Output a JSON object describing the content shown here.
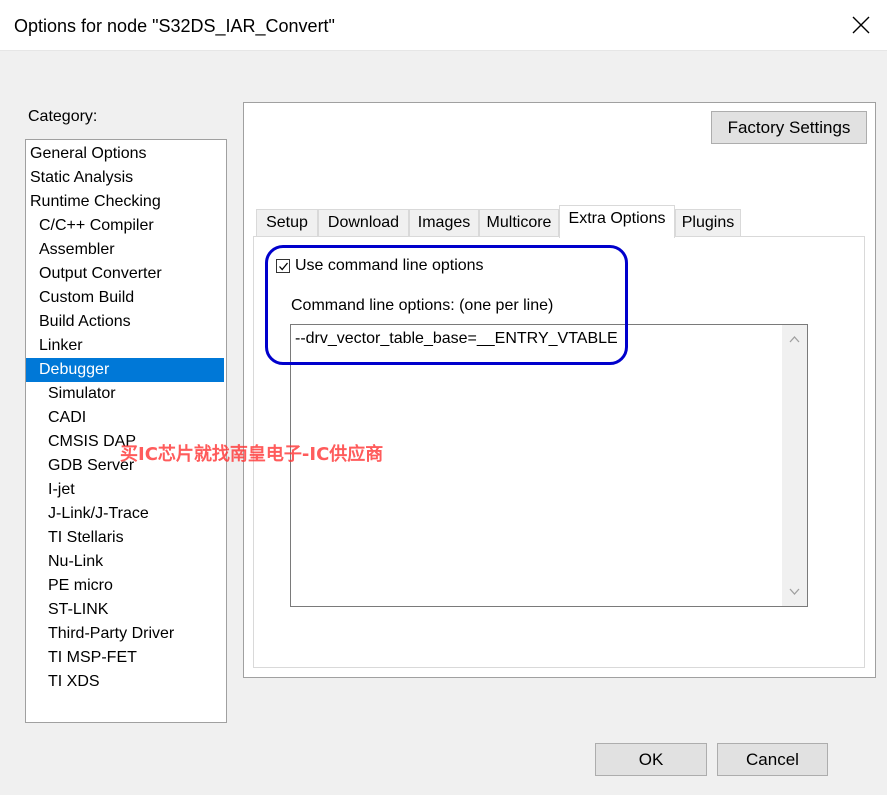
{
  "window": {
    "title": "Options for node \"S32DS_IAR_Convert\"",
    "close_icon": "close-icon"
  },
  "category": {
    "label": "Category:",
    "items": [
      {
        "label": "General Options",
        "indent": 0
      },
      {
        "label": "Static Analysis",
        "indent": 0
      },
      {
        "label": "Runtime Checking",
        "indent": 0
      },
      {
        "label": "C/C++ Compiler",
        "indent": 1
      },
      {
        "label": "Assembler",
        "indent": 1
      },
      {
        "label": "Output Converter",
        "indent": 1
      },
      {
        "label": "Custom Build",
        "indent": 1
      },
      {
        "label": "Build Actions",
        "indent": 1
      },
      {
        "label": "Linker",
        "indent": 1
      },
      {
        "label": "Debugger",
        "indent": 1,
        "selected": true
      },
      {
        "label": "Simulator",
        "indent": 2
      },
      {
        "label": "CADI",
        "indent": 2
      },
      {
        "label": "CMSIS DAP",
        "indent": 2
      },
      {
        "label": "GDB Server",
        "indent": 2
      },
      {
        "label": "I-jet",
        "indent": 2
      },
      {
        "label": "J-Link/J-Trace",
        "indent": 2
      },
      {
        "label": "TI Stellaris",
        "indent": 2
      },
      {
        "label": "Nu-Link",
        "indent": 2
      },
      {
        "label": "PE micro",
        "indent": 2
      },
      {
        "label": "ST-LINK",
        "indent": 2
      },
      {
        "label": "Third-Party Driver",
        "indent": 2
      },
      {
        "label": "TI MSP-FET",
        "indent": 2
      },
      {
        "label": "TI XDS",
        "indent": 2
      }
    ]
  },
  "factory_settings_label": "Factory Settings",
  "tabs": [
    {
      "label": "Setup"
    },
    {
      "label": "Download"
    },
    {
      "label": "Images"
    },
    {
      "label": "Multicore"
    },
    {
      "label": "Extra Options",
      "active": true
    },
    {
      "label": "Plugins"
    }
  ],
  "extra_options": {
    "use_cmd_checked": true,
    "use_cmd_label": "Use command line options",
    "cmd_label": "Command line options:  (one per line)",
    "cmd_value": "--drv_vector_table_base=__ENTRY_VTABLE"
  },
  "buttons": {
    "ok": "OK",
    "cancel": "Cancel"
  },
  "watermark": "买IC芯片就找南皇电子-IC供应商",
  "colors": {
    "selection": "#0078d7",
    "highlight_ring": "#0000cc",
    "watermark": "#ff3333"
  }
}
